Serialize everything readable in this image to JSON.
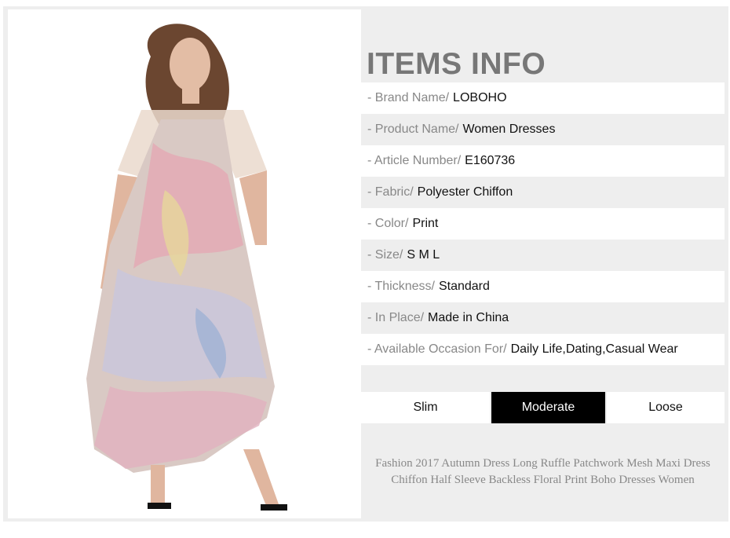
{
  "section_title": "ITEMS INFO",
  "specs": [
    {
      "label": "- Brand Name/",
      "value": "LOBOHO"
    },
    {
      "label": "- Product Name/",
      "value": "Women Dresses"
    },
    {
      "label": "- Article Number/",
      "value": "E160736"
    },
    {
      "label": "- Fabric/",
      "value": "Polyester Chiffon"
    },
    {
      "label": "- Color/",
      "value": "Print"
    },
    {
      "label": "- Size/",
      "value": "S M L"
    },
    {
      "label": "- Thickness/",
      "value": "Standard"
    },
    {
      "label": "- In Place/",
      "value": "Made in China"
    },
    {
      "label": "- Available Occasion For/",
      "value": "Daily Life,Dating,Casual Wear"
    }
  ],
  "fit_options": [
    {
      "label": "Slim",
      "selected": false
    },
    {
      "label": "Moderate",
      "selected": true
    },
    {
      "label": "Loose",
      "selected": false
    }
  ],
  "description": "Fashion 2017 Autumn Dress Long Ruffle Patchwork Mesh Maxi Dress Chiffon Half Sleeve Backless Floral Print Boho Dresses Women",
  "colors": {
    "panel_bg": "#eeeeee",
    "selected_bg": "#000000",
    "label_gray": "#888888"
  }
}
